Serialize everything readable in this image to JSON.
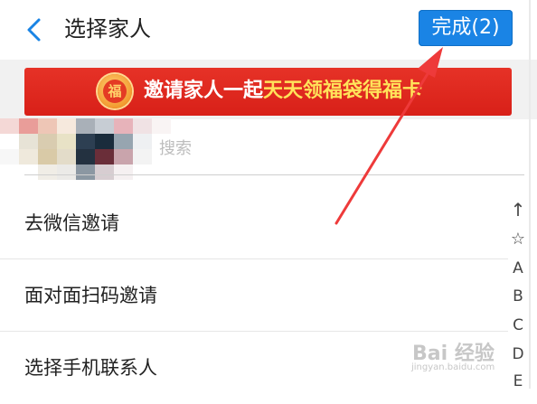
{
  "header": {
    "title": "选择家人",
    "done_label": "完成(2)"
  },
  "banner": {
    "badge_char": "福",
    "text_white": "邀请家人一起",
    "text_yellow": "天天领福袋得福卡"
  },
  "search": {
    "placeholder": "搜索"
  },
  "list": {
    "items": [
      {
        "label": "去微信邀请"
      },
      {
        "label": "面对面扫码邀请"
      },
      {
        "label": "选择手机联系人"
      }
    ]
  },
  "index_bar": [
    "↑",
    "☆",
    "A",
    "B",
    "C",
    "D",
    "E"
  ],
  "watermark": {
    "main": "Bai 经验",
    "sub": "jingyan.baidu.com"
  },
  "colors": {
    "accent": "#1a84e5",
    "banner_red": "#e02a20",
    "banner_yellow": "#ffe35a",
    "annotation_arrow": "#ee3a3a"
  }
}
